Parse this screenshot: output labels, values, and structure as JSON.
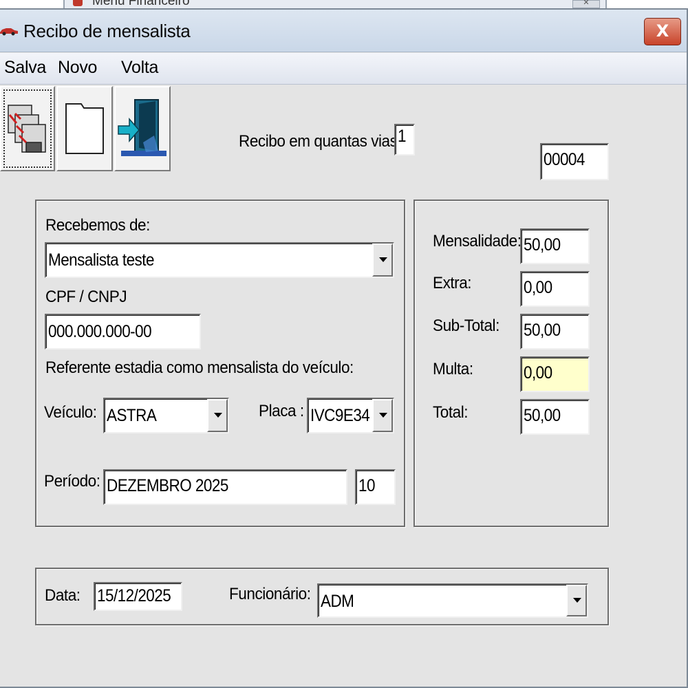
{
  "background_window": {
    "title": "Menu Financeiro"
  },
  "window": {
    "title": "Recibo de mensalista",
    "close_label": "X"
  },
  "menu": {
    "salva": "Salva",
    "novo": "Novo",
    "volta": "Volta"
  },
  "toolbar": {
    "icons": [
      "save-icon",
      "new-document-icon",
      "exit-door-icon"
    ]
  },
  "vias": {
    "label": "Recibo em quantas vias?:",
    "value": "1"
  },
  "receipt_number": "00004",
  "cliente": {
    "recebemos_label": "Recebemos de:",
    "recebemos_value": "Mensalista teste",
    "cpf_label": "CPF / CNPJ",
    "cpf_value": "000.000.000-00",
    "referente_label": "Referente estadia como mensalista do veículo:",
    "veiculo_label": "Veículo:",
    "veiculo_value": "ASTRA",
    "placa_label": "Placa :",
    "placa_value": "IVC9E34",
    "periodo_label": "Período:",
    "periodo_value": "DEZEMBRO 2025",
    "periodo_dias": "10"
  },
  "valores": {
    "mensalidade_label": "Mensalidade:",
    "mensalidade_value": "50,00",
    "extra_label": "Extra:",
    "extra_value": "0,00",
    "subtotal_label": "Sub-Total:",
    "subtotal_value": "50,00",
    "multa_label": "Multa:",
    "multa_value": "0,00",
    "total_label": "Total:",
    "total_value": "50,00"
  },
  "rodape": {
    "data_label": "Data:",
    "data_value": "15/12/2025",
    "funcionario_label": "Funcionário:",
    "funcionario_value": "ADM"
  },
  "colors": {
    "titlebar": "#c9d7e8",
    "close_button": "#c8432a",
    "dialog_bg": "#e4e4e4",
    "multa_field_bg": "#ffffcc"
  }
}
